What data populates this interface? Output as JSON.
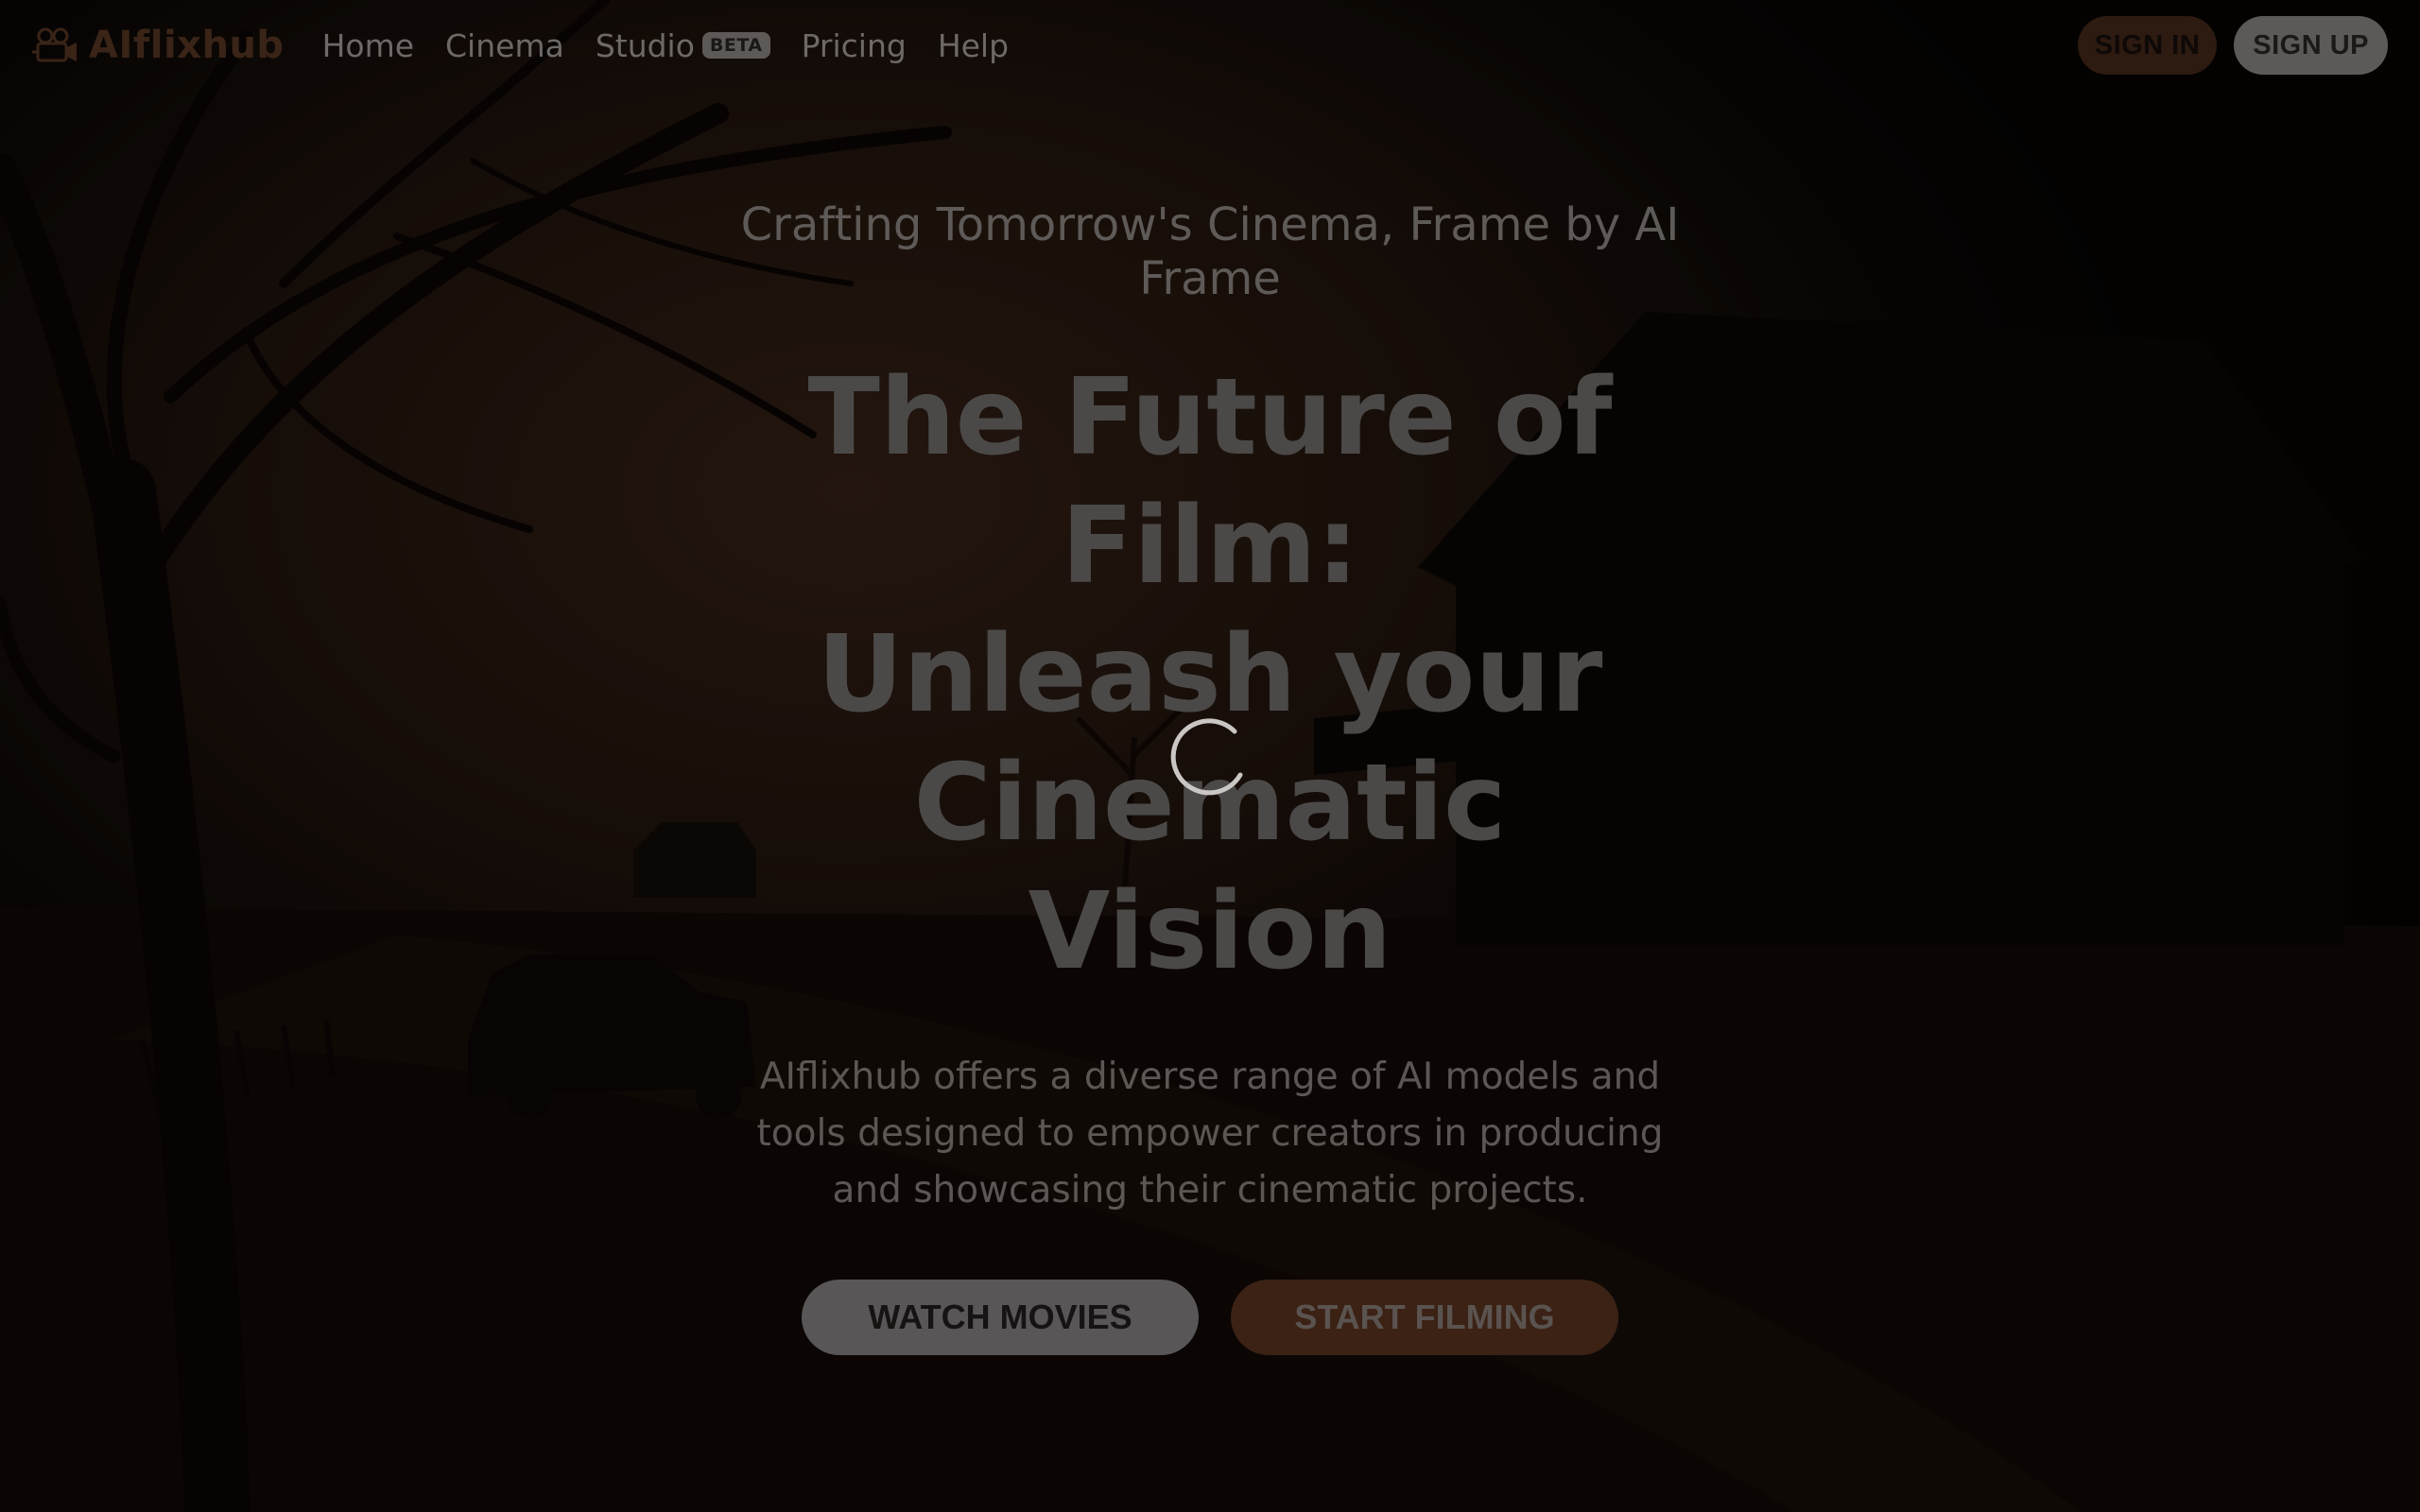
{
  "brand": {
    "name": "AIflixhub",
    "icon": "film-camera-icon",
    "color": "#3a2417"
  },
  "nav": {
    "links": [
      "Home",
      "Cinema",
      "Studio",
      "Pricing",
      "Help"
    ],
    "studio_badge": "BETA"
  },
  "auth": {
    "sign_in": "SIGN IN",
    "sign_up": "SIGN UP"
  },
  "hero": {
    "tagline": "Crafting Tomorrow's Cinema, Frame by AI Frame",
    "headline_line1": "The Future of Film:",
    "headline_line2": "Unleash your Cinematic Vision",
    "description": "AIflixhub offers a diverse range of AI models and tools designed to empower creators in producing and showcasing their cinematic projects.",
    "cta_primary": "WATCH MOVIES",
    "cta_secondary": "START FILMING"
  },
  "loading_spinner": "loading-spinner-icon",
  "colors": {
    "accent": "#3b2214",
    "overlay": "#000000"
  }
}
